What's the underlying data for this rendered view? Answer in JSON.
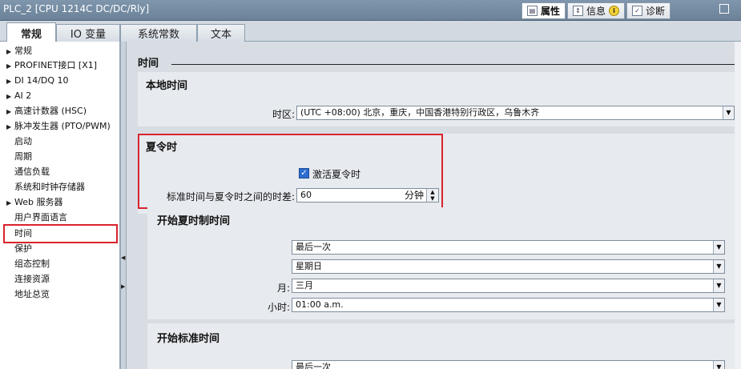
{
  "window": {
    "title": "PLC_2 [CPU 1214C DC/DC/Rly]"
  },
  "right_tabs": [
    {
      "label": "属性",
      "icon": "properties-icon",
      "active": true
    },
    {
      "label": "信息",
      "icon": "info-list-icon",
      "active": false
    },
    {
      "label": "诊断",
      "icon": "diagnostics-icon",
      "active": false
    }
  ],
  "tabs": [
    {
      "label": "常规"
    },
    {
      "label": "IO 变量"
    },
    {
      "label": "系统常数"
    },
    {
      "label": "文本"
    }
  ],
  "nav": [
    {
      "label": "常规",
      "expandable": true
    },
    {
      "label": "PROFINET接口 [X1]",
      "expandable": true
    },
    {
      "label": "DI 14/DQ 10",
      "expandable": true
    },
    {
      "label": "AI 2",
      "expandable": true
    },
    {
      "label": "高速计数器 (HSC)",
      "expandable": true
    },
    {
      "label": "脉冲发生器 (PTO/PWM)",
      "expandable": true
    },
    {
      "label": "启动",
      "expandable": false
    },
    {
      "label": "周期",
      "expandable": false
    },
    {
      "label": "通信负载",
      "expandable": false
    },
    {
      "label": "系统和时钟存储器",
      "expandable": false
    },
    {
      "label": "Web 服务器",
      "expandable": true
    },
    {
      "label": "用户界面语言",
      "expandable": false
    },
    {
      "label": "时间",
      "expandable": false,
      "selected": true
    },
    {
      "label": "保护",
      "expandable": false
    },
    {
      "label": "组态控制",
      "expandable": false
    },
    {
      "label": "连接资源",
      "expandable": false
    },
    {
      "label": "地址总览",
      "expandable": false
    }
  ],
  "content": {
    "section_title": "时间",
    "local_time": {
      "title": "本地时间",
      "timezone_label": "时区:",
      "timezone_value": "(UTC +08:00) 北京，重庆，中国香港特别行政区，乌鲁木齐"
    },
    "dst": {
      "title": "夏令时",
      "checkbox_label": "激活夏令时",
      "checked": true,
      "diff_label": "标准时间与夏令时之间的时差:",
      "diff_value": "60",
      "diff_unit": "分钟"
    },
    "dst_start": {
      "title": "开始夏时制时间",
      "week": "最后一次",
      "weekday": "星期日",
      "month_label": "月:",
      "month": "三月",
      "hour_label": "小时:",
      "hour": "01:00 a.m."
    },
    "std_start": {
      "title": "开始标准时间",
      "week": "最后一次"
    }
  },
  "colors": {
    "highlight": "#d9232d",
    "titlebar": "#6b8299",
    "checkbox": "#2b6dd1"
  }
}
